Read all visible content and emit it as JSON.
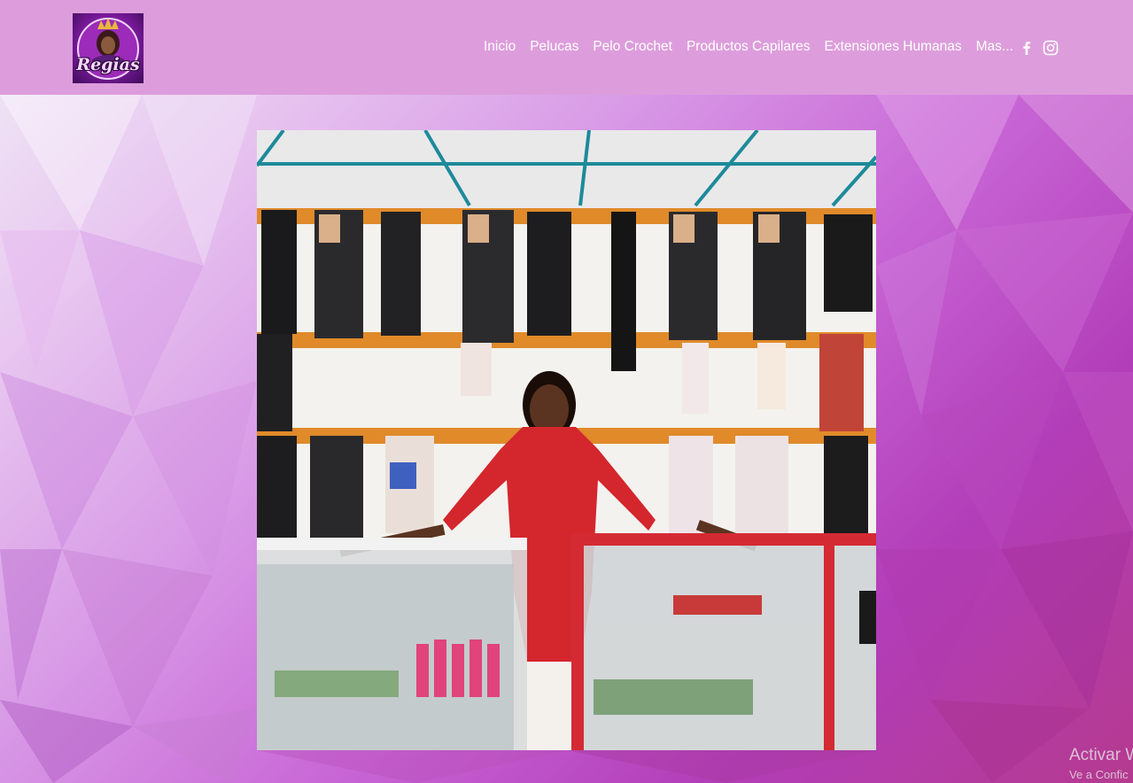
{
  "brand": {
    "logo_text": "Regias",
    "colors": {
      "header": "#dd9ddc",
      "accent": "#b23db8"
    }
  },
  "nav": {
    "items": [
      {
        "label": "Inicio"
      },
      {
        "label": "Pelucas"
      },
      {
        "label": "Pelo Crochet"
      },
      {
        "label": "Productos Capilares"
      },
      {
        "label": "Extensiones Humanas"
      }
    ],
    "more_label": "Mas..."
  },
  "social": {
    "icons": [
      "facebook-icon",
      "instagram-icon"
    ]
  },
  "watermark": {
    "title": "Activar W",
    "subtitle": "Ve a Confic"
  }
}
